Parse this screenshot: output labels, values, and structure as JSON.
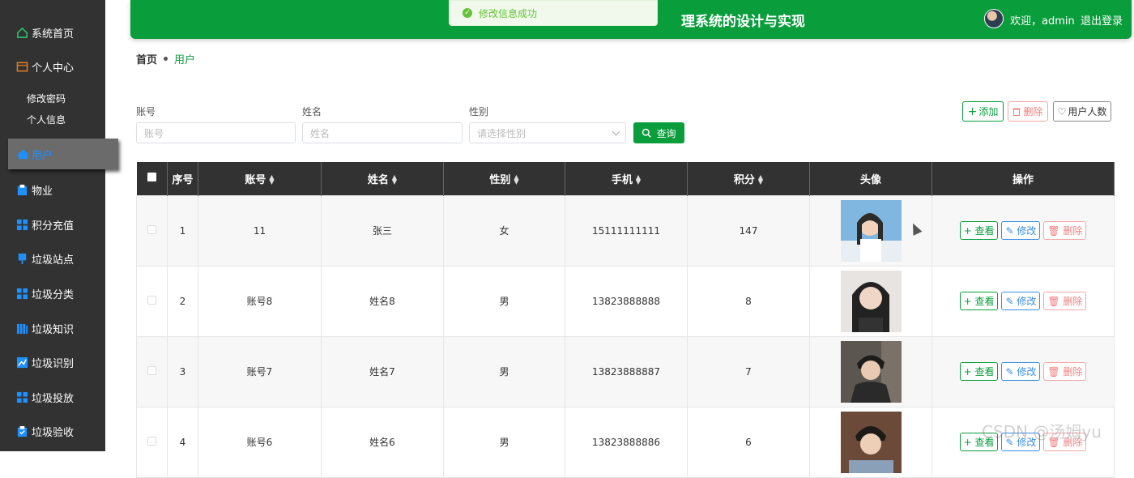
{
  "sidebar": {
    "items": [
      {
        "label": "系统首页",
        "icon": "home-icon"
      },
      {
        "label": "个人中心",
        "icon": "profile-icon"
      },
      {
        "label": "用户",
        "icon": "user-icon"
      },
      {
        "label": "物业",
        "icon": "property-icon"
      },
      {
        "label": "积分充值",
        "icon": "grid-icon"
      },
      {
        "label": "垃圾站点",
        "icon": "station-icon"
      },
      {
        "label": "垃圾分类",
        "icon": "grid-icon"
      },
      {
        "label": "垃圾知识",
        "icon": "book-icon"
      },
      {
        "label": "垃圾识别",
        "icon": "chart-icon"
      },
      {
        "label": "垃圾投放",
        "icon": "grid-icon"
      },
      {
        "label": "垃圾验收",
        "icon": "check-icon"
      }
    ],
    "sub_items": [
      "修改密码",
      "个人信息"
    ]
  },
  "header": {
    "title": "理系统的设计与实现",
    "welcome": "欢迎，admin",
    "logout": "退出登录"
  },
  "toast": {
    "message": "修改信息成功"
  },
  "breadcrumb": {
    "home": "首页",
    "current": "用户"
  },
  "filters": {
    "account": {
      "label": "账号",
      "placeholder": "账号"
    },
    "name": {
      "label": "姓名",
      "placeholder": "姓名"
    },
    "gender": {
      "label": "性别",
      "placeholder": "请选择性别"
    },
    "search_label": "查询"
  },
  "toolbar": {
    "add": "添加",
    "delete": "删除",
    "count": "用户人数"
  },
  "table": {
    "headers": [
      "序号",
      "账号",
      "姓名",
      "性别",
      "手机",
      "积分",
      "头像",
      "操作"
    ],
    "rows": [
      {
        "index": "1",
        "account": "11",
        "name": "张三",
        "gender": "女",
        "phone": "15111111111",
        "points": "147"
      },
      {
        "index": "2",
        "account": "账号8",
        "name": "姓名8",
        "gender": "男",
        "phone": "13823888888",
        "points": "8"
      },
      {
        "index": "3",
        "account": "账号7",
        "name": "姓名7",
        "gender": "男",
        "phone": "13823888887",
        "points": "7"
      },
      {
        "index": "4",
        "account": "账号6",
        "name": "姓名6",
        "gender": "男",
        "phone": "13823888886",
        "points": "6"
      }
    ],
    "actions": {
      "view": "查看",
      "edit": "修改",
      "delete": "删除"
    }
  },
  "watermark": "CSDN @汤姆yu",
  "colors": {
    "brand": "#0a9d3c",
    "sidebar": "#323232",
    "edit": "#3a8ee6",
    "delete": "#f08080"
  }
}
